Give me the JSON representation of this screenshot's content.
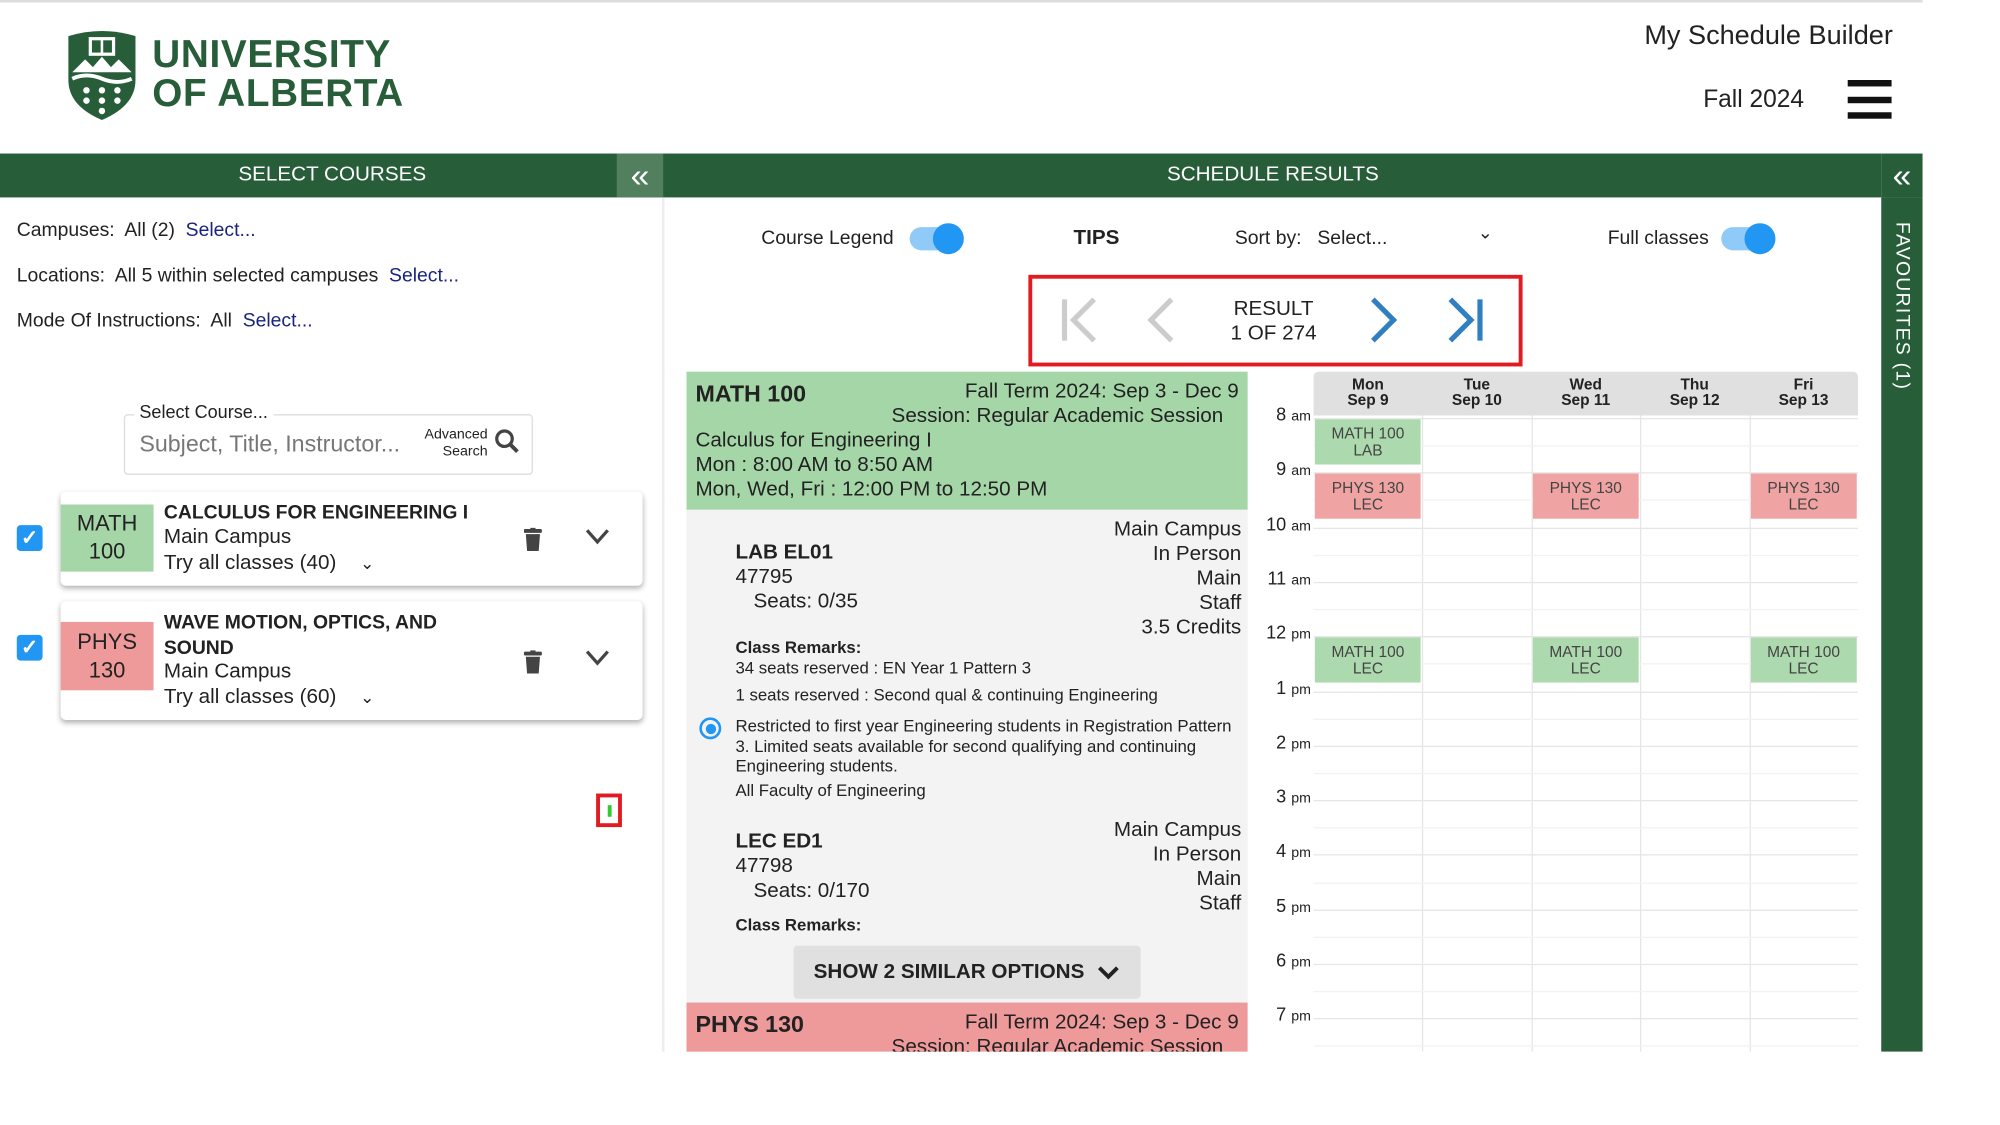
{
  "header": {
    "logo_line1": "UNIVERSITY",
    "logo_line2": "OF ALBERTA",
    "app_title": "My Schedule Builder",
    "term": "Fall 2024",
    "menu_icon": "hamburger-icon"
  },
  "left": {
    "title": "SELECT COURSES",
    "filters": [
      {
        "label": "Campuses:",
        "value": "All (2)",
        "link": "Select..."
      },
      {
        "label": "Locations:",
        "value": "All 5 within selected campuses",
        "link": "Select..."
      },
      {
        "label": "Mode Of Instructions:",
        "value": "All",
        "link": "Select..."
      }
    ],
    "search": {
      "label": "Select Course...",
      "placeholder": "Subject, Title, Instructor...",
      "advanced1": "Advanced",
      "advanced2": "Search"
    },
    "courses": [
      {
        "subject": "MATH",
        "number": "100",
        "title": "CALCULUS FOR ENGINEERING I",
        "title2": "",
        "campus": "Main Campus",
        "try": "Try all classes (40)",
        "color": "#a5d6a7",
        "checked": true
      },
      {
        "subject": "PHYS",
        "number": "130",
        "title": "WAVE MOTION, OPTICS, AND",
        "title2": "SOUND",
        "campus": "Main Campus",
        "try": "Try all classes (60)",
        "color": "#ef9a9a",
        "checked": true
      }
    ]
  },
  "right": {
    "title": "SCHEDULE RESULTS",
    "course_legend": "Course Legend",
    "course_legend_on": true,
    "tips": "TIPS",
    "sort_label": "Sort by:",
    "sort_value": "Select...",
    "full_classes": "Full classes",
    "full_classes_on": true,
    "result_label": "RESULT",
    "result_count": "1 OF 274",
    "favourites": "FAVOURITES (1)"
  },
  "math_card": {
    "code": "MATH 100",
    "term": "Fall Term 2024: Sep 3 - Dec 9",
    "session": "Session: Regular Academic Session",
    "name": "Calculus for Engineering I",
    "time1": "Mon : 8:00 AM to 8:50 AM",
    "time2": "Mon, Wed, Fri : 12:00 PM to 12:50 PM",
    "lab": {
      "section": "LAB EL01",
      "id": "47795",
      "seats": "Seats: 0/35",
      "campus": "Main Campus",
      "mode": "In Person",
      "location": "Main",
      "instructor": "Staff",
      "credits": "3.5 Credits",
      "remarks_label": "Class Remarks:",
      "remark1": "34 seats reserved : EN Year 1 Pattern 3",
      "remark2": "1 seats reserved : Second qual & continuing Engineering",
      "note1": "Restricted to first year Engineering students in Registration Pattern",
      "note2": "3. Limited seats available for second qualifying and continuing",
      "note3": "Engineering students.",
      "note4": "All Faculty of Engineering"
    },
    "lec": {
      "section": "LEC ED1",
      "id": "47798",
      "seats": "Seats: 0/170",
      "campus": "Main Campus",
      "mode": "In Person",
      "location": "Main",
      "instructor": "Staff",
      "remarks_label": "Class Remarks:"
    },
    "similar": "SHOW 2 SIMILAR OPTIONS"
  },
  "phys_card": {
    "code": "PHYS 130",
    "term": "Fall Term 2024: Sep 3 - Dec 9",
    "session": "Session: Regular Academic Session"
  },
  "calendar": {
    "days": [
      {
        "d": "Mon",
        "date": "Sep 9"
      },
      {
        "d": "Tue",
        "date": "Sep 10"
      },
      {
        "d": "Wed",
        "date": "Sep 11"
      },
      {
        "d": "Thu",
        "date": "Sep 12"
      },
      {
        "d": "Fri",
        "date": "Sep 13"
      }
    ],
    "hours": [
      {
        "h": "8",
        "ap": "am"
      },
      {
        "h": "9",
        "ap": "am"
      },
      {
        "h": "10",
        "ap": "am"
      },
      {
        "h": "11",
        "ap": "am"
      },
      {
        "h": "12",
        "ap": "pm"
      },
      {
        "h": "1",
        "ap": "pm"
      },
      {
        "h": "2",
        "ap": "pm"
      },
      {
        "h": "3",
        "ap": "pm"
      },
      {
        "h": "4",
        "ap": "pm"
      },
      {
        "h": "5",
        "ap": "pm"
      },
      {
        "h": "6",
        "ap": "pm"
      },
      {
        "h": "7",
        "ap": "pm"
      }
    ],
    "events": [
      {
        "day": 0,
        "start": 8,
        "end": 8.83,
        "l1": "MATH 100",
        "l2": "LAB",
        "color": "#acd9ae"
      },
      {
        "day": 0,
        "start": 9,
        "end": 9.83,
        "l1": "PHYS 130",
        "l2": "LEC",
        "color": "#efa3a3"
      },
      {
        "day": 2,
        "start": 9,
        "end": 9.83,
        "l1": "PHYS 130",
        "l2": "LEC",
        "color": "#efa3a3"
      },
      {
        "day": 4,
        "start": 9,
        "end": 9.83,
        "l1": "PHYS 130",
        "l2": "LEC",
        "color": "#efa3a3"
      },
      {
        "day": 0,
        "start": 12,
        "end": 12.83,
        "l1": "MATH 100",
        "l2": "LEC",
        "color": "#acd9ae"
      },
      {
        "day": 2,
        "start": 12,
        "end": 12.83,
        "l1": "MATH 100",
        "l2": "LEC",
        "color": "#acd9ae"
      },
      {
        "day": 4,
        "start": 12,
        "end": 12.83,
        "l1": "MATH 100",
        "l2": "LEC",
        "color": "#acd9ae"
      }
    ]
  },
  "colors": {
    "brand": "#275d38",
    "accent": "#2196f3",
    "highlight": "#e21b23"
  }
}
